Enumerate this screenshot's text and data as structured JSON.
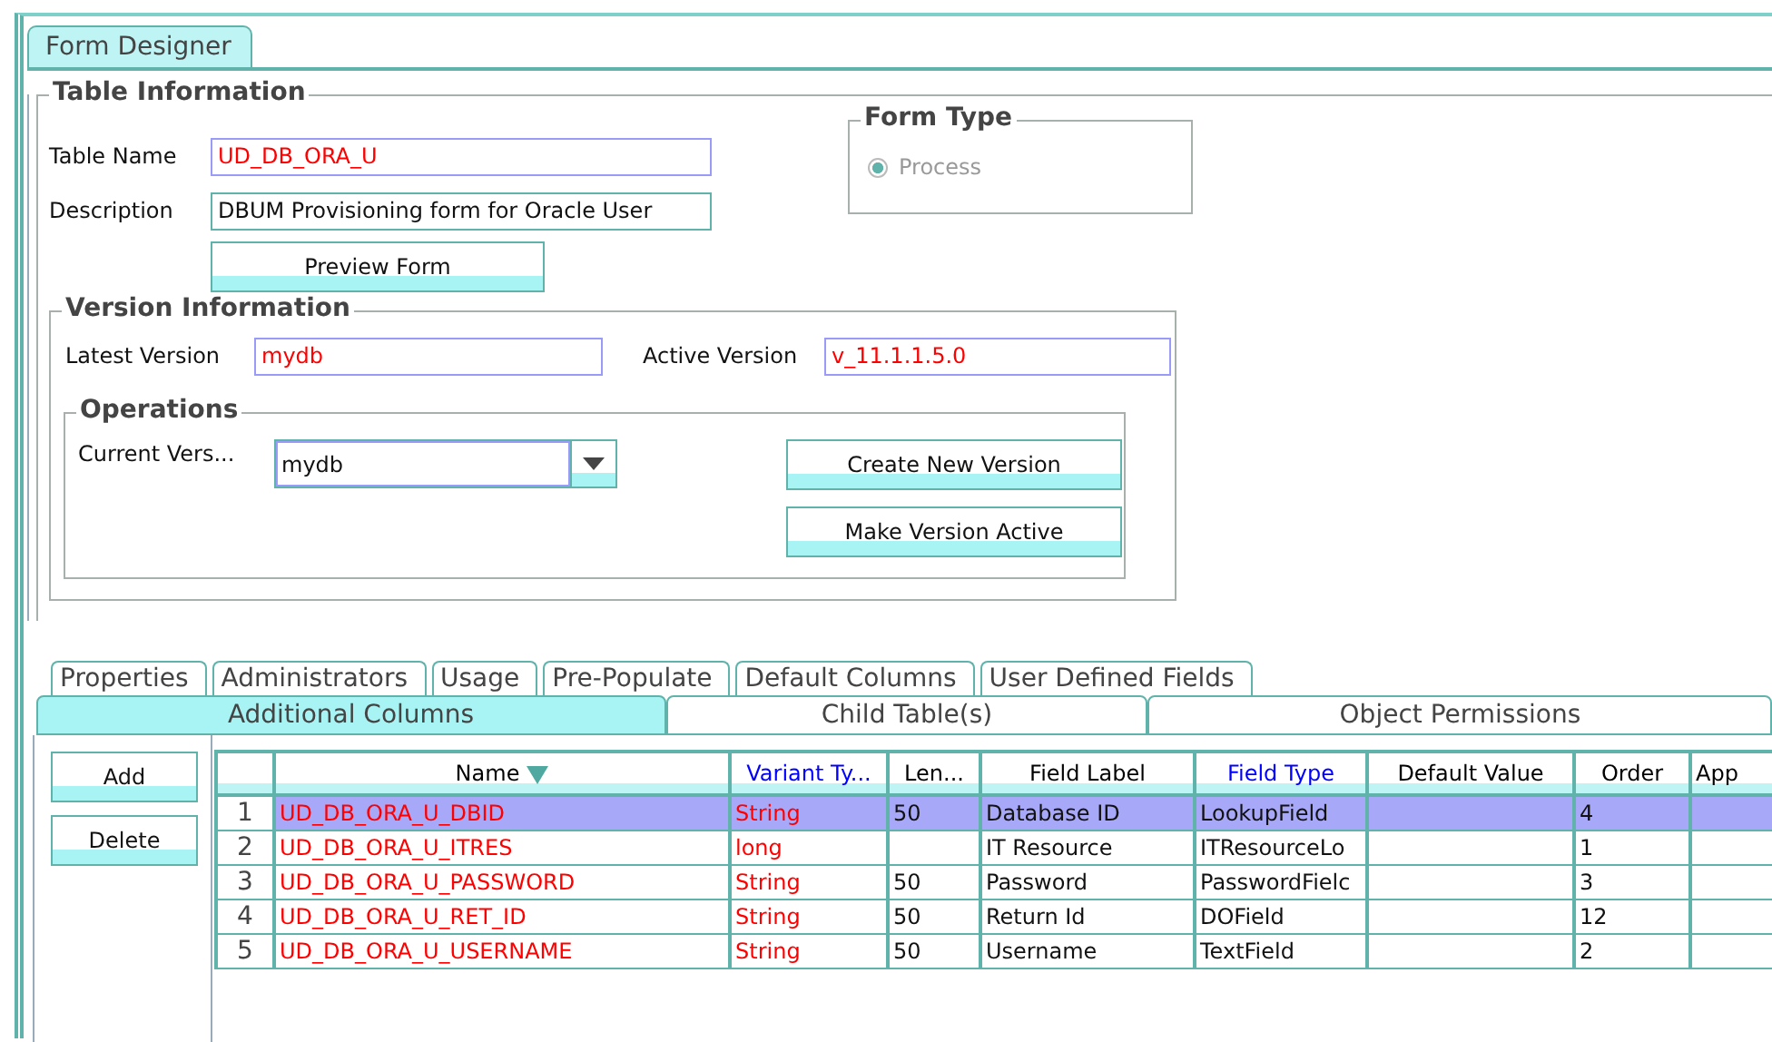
{
  "main_tab": {
    "label": "Form Designer",
    "selected": true
  },
  "table_information": {
    "title": "Table Information",
    "fields": [
      {
        "label": "Table Name",
        "value": "UD_DB_ORA_U",
        "required": true
      },
      {
        "label": "Description",
        "value": "DBUM Provisioning form for Oracle User",
        "required": false
      }
    ],
    "preview_button": "Preview Form",
    "form_type": {
      "title": "Form Type",
      "options": [
        {
          "label": "Process",
          "selected": true,
          "disabled": true
        }
      ]
    }
  },
  "version_information": {
    "title": "Version Information",
    "fields": [
      {
        "label": "Latest Version",
        "value": "mydb",
        "required": true
      },
      {
        "label": "Active Version",
        "value": "v_11.1.1.5.0",
        "required": true
      }
    ],
    "operations": {
      "title": "Operations",
      "current_version_label": "Current Vers...",
      "current_version": "mydb",
      "buttons": [
        "Create New Version",
        "Make Version Active"
      ]
    }
  },
  "tab_rows": [
    [
      {
        "label": "Properties",
        "selected": false
      },
      {
        "label": "Administrators",
        "selected": false
      },
      {
        "label": "Usage",
        "selected": false
      },
      {
        "label": "Pre-Populate",
        "selected": false
      },
      {
        "label": "Default Columns",
        "selected": false
      },
      {
        "label": "User Defined Fields",
        "selected": false
      }
    ],
    [
      {
        "label": "Additional Columns",
        "selected": true
      },
      {
        "label": "Child Table(s)",
        "selected": false
      },
      {
        "label": "Object Permissions",
        "selected": false
      }
    ]
  ],
  "side_buttons": [
    "Add",
    "Delete"
  ],
  "table": {
    "columns": [
      {
        "label": "Name",
        "color": "#000000",
        "required": true,
        "sorted": true
      },
      {
        "label": "Variant Ty...",
        "color": "#0000ff",
        "required": true
      },
      {
        "label": "Len...",
        "color": "#000000",
        "required": false
      },
      {
        "label": "Field Label",
        "color": "#000000",
        "required": false
      },
      {
        "label": "Field Type",
        "color": "#0000ff",
        "required": false
      },
      {
        "label": "Default Value",
        "color": "#000000"
      },
      {
        "label": "Order",
        "color": "#000000",
        "required": false
      },
      {
        "label": "App",
        "color": "#000000"
      }
    ],
    "rows": [
      {
        "number": "1",
        "selected": true,
        "cells": [
          "UD_DB_ORA_U_DBID",
          "String",
          "50",
          "Database ID",
          "LookupField",
          null,
          "4",
          null
        ]
      },
      {
        "number": "2",
        "selected": false,
        "cells": [
          "UD_DB_ORA_U_ITRES",
          "long",
          null,
          "IT Resource",
          "ITResourceLo",
          null,
          "1",
          null
        ]
      },
      {
        "number": "3",
        "selected": false,
        "cells": [
          "UD_DB_ORA_U_PASSWORD",
          "String",
          "50",
          "Password",
          "PasswordFielc",
          null,
          "3",
          null
        ]
      },
      {
        "number": "4",
        "selected": false,
        "cells": [
          "UD_DB_ORA_U_RET_ID",
          "String",
          "50",
          "Return Id",
          "DOField",
          null,
          "12",
          null
        ]
      },
      {
        "number": "5",
        "selected": false,
        "cells": [
          "UD_DB_ORA_U_USERNAME",
          "String",
          "50",
          "Username",
          "TextField",
          null,
          "2",
          null
        ]
      }
    ]
  }
}
